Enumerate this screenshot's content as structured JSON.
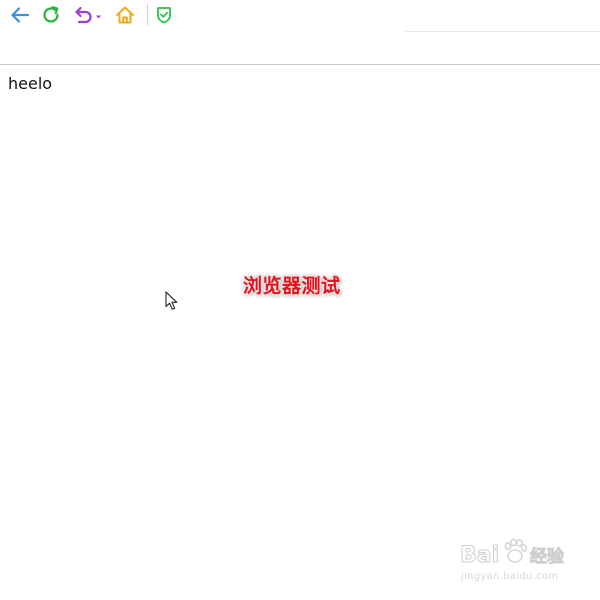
{
  "toolbar": {
    "icons": {
      "back": "back-arrow-icon",
      "refresh": "refresh-icon",
      "undo": "undo-dropdown-icon",
      "home": "home-icon",
      "shield": "shield-check-icon"
    },
    "colors": {
      "back": "#3b8fe0",
      "refresh": "#28b33c",
      "undo": "#9b3fd6",
      "home": "#f0a818",
      "shield": "#2fbf4e"
    }
  },
  "page": {
    "text": "heelo"
  },
  "overlay": {
    "caption": "浏览器测试",
    "caption_color": "#e8101a"
  },
  "watermark": {
    "logo_text": "Bai 经验",
    "url": "jingyan.baidu.com"
  }
}
